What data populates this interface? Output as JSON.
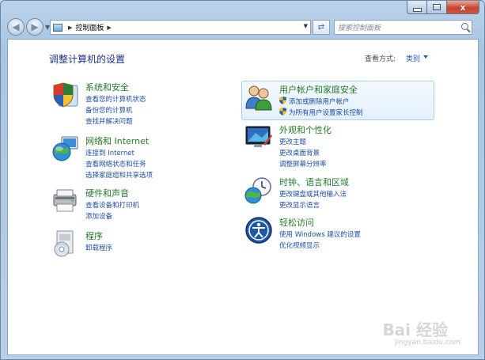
{
  "window": {
    "caption": {
      "close": "x"
    }
  },
  "address": {
    "path": "控制面板",
    "search_placeholder": "搜索控制面板"
  },
  "header": {
    "title": "调整计算机的设置",
    "view_by_label": "查看方式:",
    "view_by_value": "类别"
  },
  "categories": [
    {
      "title": "系统和安全",
      "icon": "system-security-icon",
      "links": [
        "查看您的计算机状态",
        "备份您的计算机",
        "查找并解决问题"
      ]
    },
    {
      "title": "网络和 Internet",
      "icon": "network-internet-icon",
      "links": [
        "连接到 Internet",
        "查看网络状态和任务",
        "选择家庭组和共享选项"
      ]
    },
    {
      "title": "硬件和声音",
      "icon": "hardware-sound-icon",
      "links": [
        "查看设备和打印机",
        "添加设备"
      ]
    },
    {
      "title": "程序",
      "icon": "programs-icon",
      "links": [
        "卸载程序"
      ]
    },
    {
      "title": "用户帐户和家庭安全",
      "icon": "user-accounts-icon",
      "links": [
        "添加或删除用户帐户",
        "为所有用户设置家长控制"
      ]
    },
    {
      "title": "外观和个性化",
      "icon": "appearance-icon",
      "links": [
        "更改主题",
        "更改桌面背景",
        "调整屏幕分辨率"
      ]
    },
    {
      "title": "时钟、语言和区域",
      "icon": "clock-language-region-icon",
      "links": [
        "更改键盘或其他输入法",
        "更改显示语言"
      ]
    },
    {
      "title": "轻松访问",
      "icon": "ease-of-access-icon",
      "links": [
        "使用 Windows 建议的设置",
        "优化视频显示"
      ]
    }
  ],
  "watermark": {
    "brand": "Bai 经验",
    "url": "jingyan.baidu.com"
  }
}
